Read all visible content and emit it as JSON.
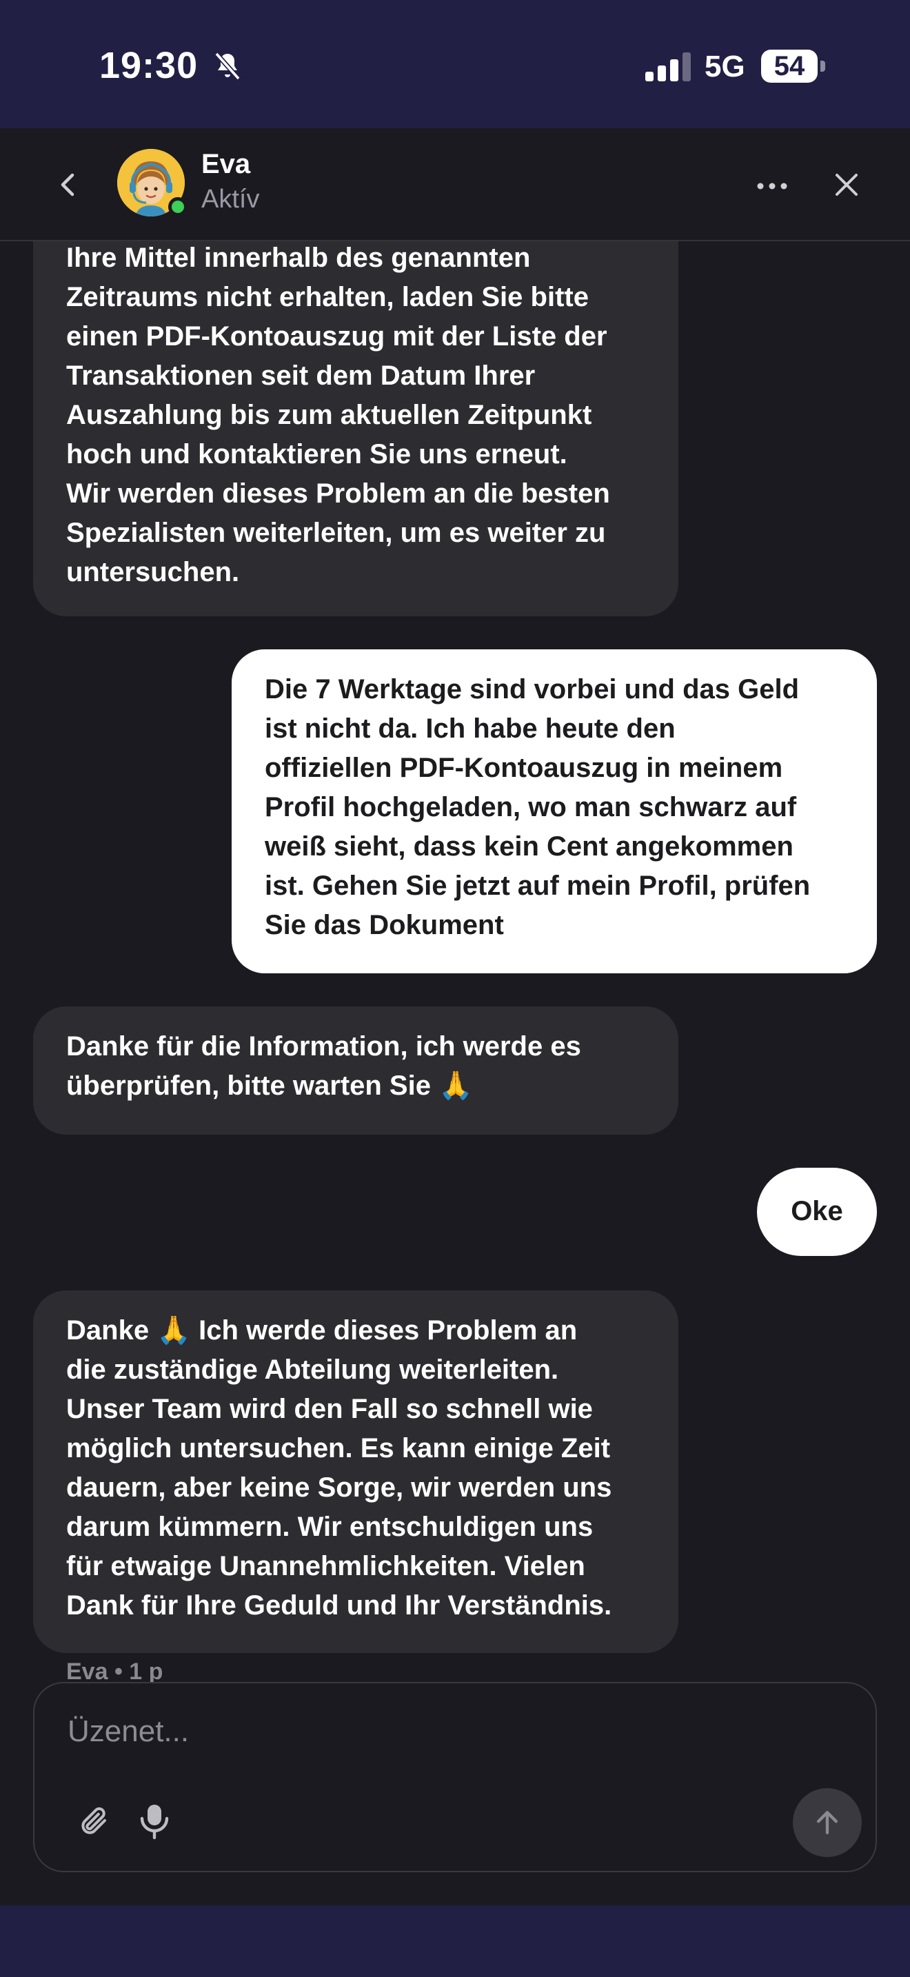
{
  "status_bar": {
    "time": "19:30",
    "network": "5G",
    "battery": "54"
  },
  "header": {
    "name": "Eva",
    "status": "Aktív"
  },
  "messages": [
    {
      "from": "agent",
      "text": "Ihre Mittel innerhalb des genannten\nZeitraums nicht erhalten, laden Sie bitte\neinen PDF-Kontoauszug mit der Liste der\nTransaktionen seit dem Datum Ihrer\nAuszahlung bis zum aktuellen Zeitpunkt\nhoch und kontaktieren Sie uns erneut.\nWir werden dieses Problem an die besten\nSpezialisten weiterleiten, um es weiter zu\nuntersuchen."
    },
    {
      "from": "user",
      "text": "Die 7 Werktage sind vorbei und das Geld\nist nicht da. Ich habe heute den\noffiziellen PDF-Kontoauszug in meinem\nProfil hochgeladen, wo man schwarz auf\nweiß sieht, dass kein Cent angekommen\nist. Gehen Sie jetzt auf mein Profil, prüfen\nSie das Dokument"
    },
    {
      "from": "agent",
      "text": "Danke für die Information, ich werde es\nüberprüfen, bitte warten Sie 🙏"
    },
    {
      "from": "user",
      "text": "Oke"
    },
    {
      "from": "agent",
      "text": "Danke 🙏 Ich werde dieses Problem an\ndie zuständige Abteilung weiterleiten.\nUnser Team wird den Fall so schnell wie\nmöglich untersuchen. Es kann einige Zeit\ndauern, aber keine Sorge, wir werden uns\ndarum kümmern. Wir entschuldigen uns\nfür etwaige Unannehmlichkeiten. Vielen\nDank für Ihre Geduld und Ihr Verständnis."
    }
  ],
  "last_meta": "Eva • 1 p",
  "composer": {
    "placeholder": "Üzenet..."
  },
  "icons": {
    "back": "chevron-left-icon",
    "more": "more-horizontal-icon",
    "close": "close-icon",
    "attach": "paperclip-icon",
    "mic": "microphone-icon",
    "send": "arrow-up-icon",
    "silent": "bell-off-icon"
  },
  "colors": {
    "status_bar_bg": "#221f45",
    "background": "#1b1a20",
    "agent_bubble": "#2c2c31",
    "user_bubble": "#ffffff",
    "online": "#3ecf56"
  }
}
